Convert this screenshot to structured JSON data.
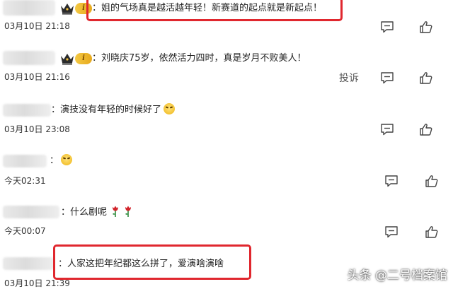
{
  "comments": [
    {
      "text": "：姐的气场真是越活越年轻！新赛道的起点就是新起点！",
      "time": "03月10日 21:18",
      "level": "i"
    },
    {
      "text": "：刘晓庆75岁，依然活力四时，真是岁月不败美人！",
      "time": "03月10日 21:16",
      "level": "i",
      "report": "投诉"
    },
    {
      "text": "：演技没有年轻的时候好了",
      "time": "03月10日 23:08"
    },
    {
      "text": "：",
      "time": "今天02:31"
    },
    {
      "text": "：什么剧呢",
      "time": "今天00:07"
    },
    {
      "text": "：人家这把年纪都这么拼了，爱演啥演啥",
      "time": "03月10日 21:39"
    }
  ],
  "watermark": "头条 @二号档案馆",
  "colors": {
    "highlight": "#e0272e",
    "badge": "#e7a91d"
  },
  "icons": {
    "reply": "comment-icon",
    "like": "thumbs-up-icon",
    "crown": "crown-icon",
    "emoji": "laugh-cry-emoji",
    "rose": "rose-icon"
  }
}
